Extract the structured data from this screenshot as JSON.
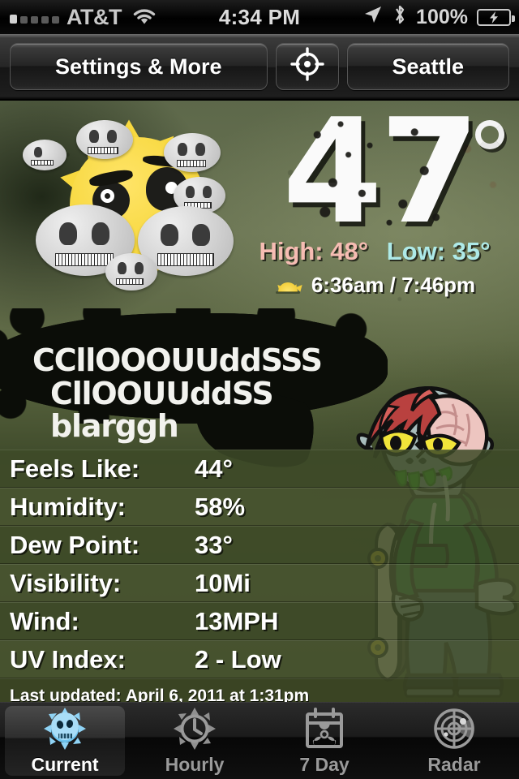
{
  "statusbar": {
    "carrier": "AT&T",
    "time": "4:34 PM",
    "battery_pct": "100%",
    "icons": {
      "wifi": "wifi-icon",
      "location": "location-arrow-icon",
      "bluetooth": "bluetooth-icon",
      "battery": "battery-charging-icon"
    }
  },
  "navbar": {
    "settings_label": "Settings & More",
    "locate_icon": "crosshair-icon",
    "city_label": "Seattle"
  },
  "current": {
    "temperature": "47",
    "degree_symbol": "°",
    "high_label": "High: 48°",
    "low_label": "Low: 35°",
    "sunrise_sunset": "6:36am /  7:46pm",
    "sun_icon": "sunrise-icon",
    "weather_icon": "zombie-sun-behind-clouds-icon",
    "speech_line1": "CCllOOOUUddSSS",
    "speech_line2": "CllOOUUddSS  blarggh",
    "character": "skater-zombie-illustration"
  },
  "details": {
    "rows": [
      {
        "label": "Feels Like:",
        "value": "44°"
      },
      {
        "label": "Humidity:",
        "value": "58%"
      },
      {
        "label": "Dew Point:",
        "value": "33°"
      },
      {
        "label": "Visibility:",
        "value": "10Mi"
      },
      {
        "label": "Wind:",
        "value": "13MPH"
      },
      {
        "label": "UV Index:",
        "value": "2 - Low"
      }
    ],
    "last_updated": "Last updated: April 6, 2011 at 1:31pm"
  },
  "tabs": [
    {
      "label": "Current",
      "icon": "zombie-sun-icon",
      "active": true
    },
    {
      "label": "Hourly",
      "icon": "clock-sun-icon",
      "active": false
    },
    {
      "label": "7 Day",
      "icon": "biohazard-calendar-icon",
      "active": false
    },
    {
      "label": "Radar",
      "icon": "radar-sweep-icon",
      "active": false
    }
  ],
  "colors": {
    "high": "#f6bcb3",
    "low": "#aeeae8",
    "background_green": "#6a7453",
    "bubble_black": "#0b0d08",
    "accent_blue": "#45b4ef"
  }
}
